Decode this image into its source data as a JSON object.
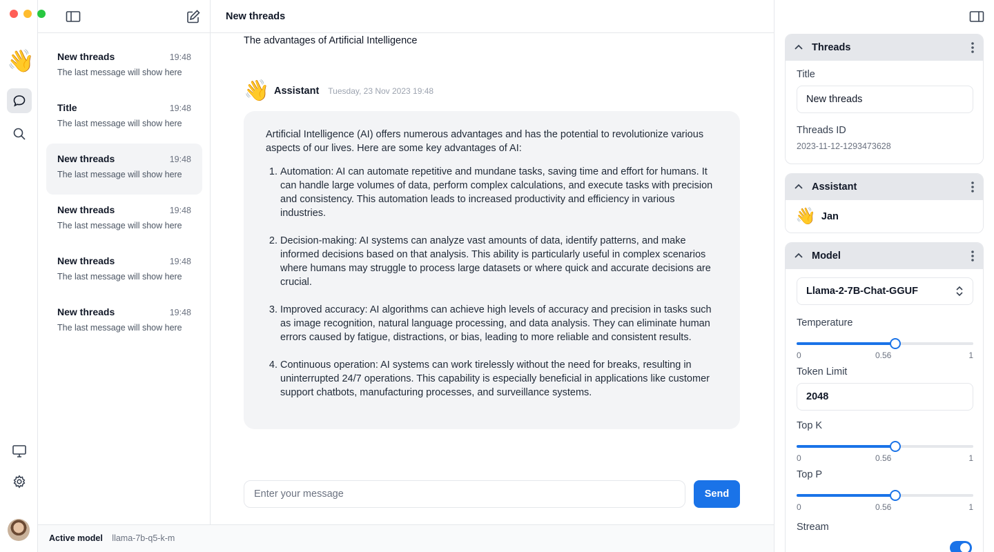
{
  "window": {
    "traffic_colors": [
      "#ff5f57",
      "#febc2e",
      "#28c840"
    ]
  },
  "rail": {
    "logo": "👋"
  },
  "thread_list": {
    "items": [
      {
        "title": "New threads",
        "time": "19:48",
        "preview": "The last message will show here",
        "selected": false
      },
      {
        "title": "Title",
        "time": "19:48",
        "preview": "The last message will show here",
        "selected": false
      },
      {
        "title": "New threads",
        "time": "19:48",
        "preview": "The last message will show here",
        "selected": true
      },
      {
        "title": "New threads",
        "time": "19:48",
        "preview": "The last message will show here",
        "selected": false
      },
      {
        "title": "New threads",
        "time": "19:48",
        "preview": "The last message will show here",
        "selected": false
      },
      {
        "title": "New threads",
        "time": "19:48",
        "preview": "The last message will show here",
        "selected": false
      }
    ]
  },
  "main": {
    "title": "New threads",
    "previous_message": "The advantages of Artificial Intelligence",
    "assistant": {
      "emoji": "👋",
      "name": "Assistant",
      "date": "Tuesday, 23 Nov 2023 19:48"
    },
    "response": {
      "intro": "Artificial Intelligence (AI) offers numerous advantages and has the potential to revolutionize various aspects of our lives. Here are some key advantages of AI:",
      "points": [
        "Automation: AI can automate repetitive and mundane tasks, saving time and effort for humans. It can handle large volumes of data, perform complex calculations, and execute tasks with precision and consistency. This automation leads to increased productivity and efficiency in various industries.",
        "Decision-making: AI systems can analyze vast amounts of data, identify patterns, and make informed decisions based on that analysis. This ability is particularly useful in complex scenarios where humans may struggle to process large datasets or where quick and accurate decisions are crucial.",
        "Improved accuracy: AI algorithms can achieve high levels of accuracy and precision in tasks such as image recognition, natural language processing, and data analysis. They can eliminate human errors caused by fatigue, distractions, or bias, leading to more reliable and consistent results.",
        "Continuous operation: AI systems can work tirelessly without the need for breaks, resulting in uninterrupted 24/7 operations. This capability is especially beneficial in applications like customer support chatbots, manufacturing processes, and surveillance systems."
      ]
    },
    "composer": {
      "placeholder": "Enter your message",
      "send_label": "Send"
    }
  },
  "status_bar": {
    "label": "Active model",
    "value": "llama-7b-q5-k-m"
  },
  "right_panel": {
    "threads": {
      "header": "Threads",
      "title_label": "Title",
      "title_value": "New threads",
      "id_label": "Threads ID",
      "id_value": "2023-11-12-1293473628"
    },
    "assistant": {
      "header": "Assistant",
      "emoji": "👋",
      "name": "Jan"
    },
    "model": {
      "header": "Model",
      "selected_model": "Llama-2-7B-Chat-GGUF",
      "temperature": {
        "label": "Temperature",
        "min": "0",
        "max": "1",
        "value": "0.56",
        "fraction": 0.56
      },
      "token_limit": {
        "label": "Token Limit",
        "value": "2048"
      },
      "top_k": {
        "label": "Top K",
        "min": "0",
        "max": "1",
        "value": "0.56",
        "fraction": 0.56
      },
      "top_p": {
        "label": "Top P",
        "min": "0",
        "max": "1",
        "value": "0.56",
        "fraction": 0.56
      },
      "stream": {
        "label": "Stream",
        "enabled": true
      }
    }
  },
  "colors": {
    "accent": "#1a73e8",
    "panel_header": "#e5e7eb",
    "bubble": "#f3f4f6"
  }
}
